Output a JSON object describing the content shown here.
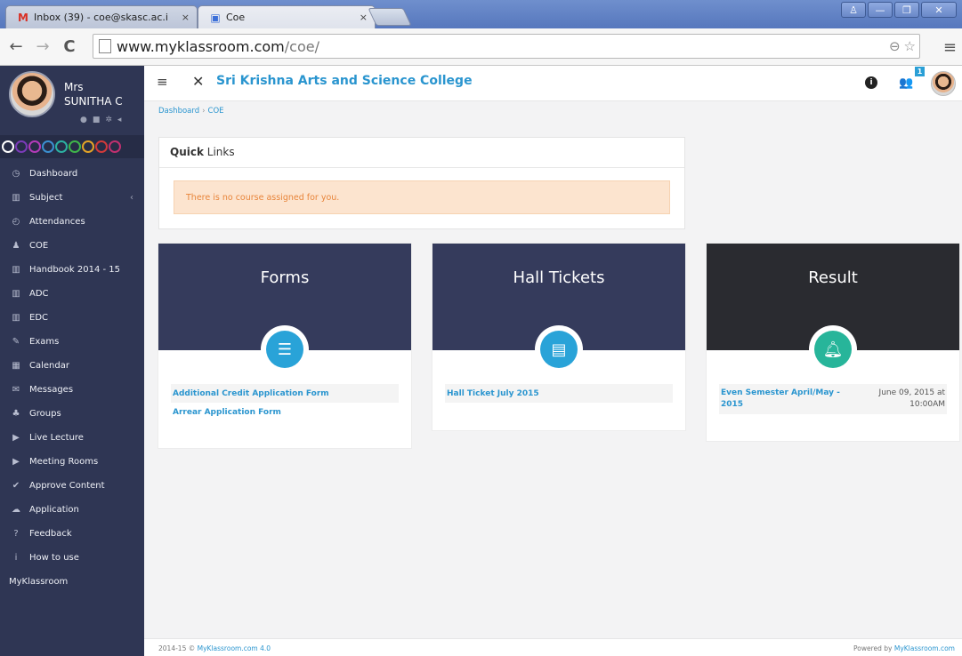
{
  "browser": {
    "tabs": [
      {
        "title": "Inbox (39) - coe@skasc.ac.i",
        "close": "×"
      },
      {
        "title": "Coe",
        "close": "×"
      }
    ],
    "address": {
      "host": "www.myklassroom.com",
      "path": "/coe/"
    }
  },
  "user": {
    "title": "Mrs",
    "name": "SUNITHA C"
  },
  "theme_colors": [
    "#ffffff",
    "#7a3bb8",
    "#b23bb8",
    "#3b8fd0",
    "#2cb0a1",
    "#3fb54a",
    "#e2a327",
    "#d13a3a",
    "#c0306f"
  ],
  "sidebar": {
    "items": [
      {
        "label": "Dashboard",
        "icon": "dashboard-icon"
      },
      {
        "label": "Subject",
        "icon": "book-icon"
      },
      {
        "label": "Attendances",
        "icon": "clock-icon"
      },
      {
        "label": "COE",
        "icon": "award-icon"
      },
      {
        "label": "Handbook 2014 - 15",
        "icon": "book-icon"
      },
      {
        "label": "ADC",
        "icon": "book-icon"
      },
      {
        "label": "EDC",
        "icon": "book-icon"
      },
      {
        "label": "Exams",
        "icon": "edit-icon"
      },
      {
        "label": "Calendar",
        "icon": "calendar-icon"
      },
      {
        "label": "Messages",
        "icon": "envelope-icon"
      },
      {
        "label": "Groups",
        "icon": "users-icon"
      },
      {
        "label": "Live Lecture",
        "icon": "video-icon"
      },
      {
        "label": "Meeting Rooms",
        "icon": "video-icon"
      },
      {
        "label": "Approve Content",
        "icon": "check-icon"
      },
      {
        "label": "Application",
        "icon": "cloud-icon"
      },
      {
        "label": "Feedback",
        "icon": "question-icon"
      },
      {
        "label": "How to use",
        "icon": "info-icon"
      }
    ],
    "brand": "MyKlassroom"
  },
  "header": {
    "title": "Sri Krishna Arts and Science College",
    "notification_count": "1"
  },
  "breadcrumb": {
    "home": "Dashboard",
    "current": "COE"
  },
  "quick_links": {
    "title_bold": "Quick",
    "title_rest": "Links",
    "alert": "There is no course assigned for you."
  },
  "cards": {
    "forms": {
      "title": "Forms",
      "color": "#353b5c",
      "icon_color": "#29a3d8",
      "links": [
        "Additional Credit Application Form",
        "Arrear Application Form"
      ]
    },
    "hall": {
      "title": "Hall Tickets",
      "color": "#353b5c",
      "icon_color": "#29a3d8",
      "links": [
        "Hall Ticket July 2015"
      ]
    },
    "result": {
      "title": "Result",
      "color": "#2a2b30",
      "icon_color": "#27b59a",
      "item": "Even Semester April/May - 2015",
      "date": "June 09, 2015 at 10:00AM"
    }
  },
  "footer": {
    "copyright": "2014-15 © ",
    "brand_link": "MyKlassroom.com 4.0",
    "powered": "Powered by ",
    "powered_link": "MyKlassroom.com"
  }
}
